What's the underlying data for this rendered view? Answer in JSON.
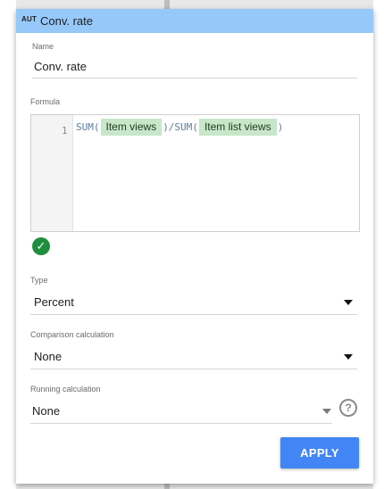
{
  "header": {
    "badge": "AUT",
    "title": "Conv. rate"
  },
  "name_field": {
    "label": "Name",
    "value": "Conv. rate"
  },
  "formula": {
    "label": "Formula",
    "line_number": "1",
    "fn1": "SUM(",
    "field1": "Item views",
    "mid": ")/SUM(",
    "field2": "Item list views",
    "close": ")",
    "valid_icon": "check-circle-icon"
  },
  "type_field": {
    "label": "Type",
    "value": "Percent"
  },
  "comparison": {
    "label": "Comparison calculation",
    "value": "None"
  },
  "running": {
    "label": "Running calculation",
    "value": "None",
    "help_icon": "question-circle-icon",
    "help_text": "?"
  },
  "apply_button": {
    "label": "APPLY"
  },
  "colors": {
    "header": "#96c9f9",
    "apply": "#4285f4",
    "chip": "#c8e6c9",
    "valid": "#1e8e3e"
  }
}
